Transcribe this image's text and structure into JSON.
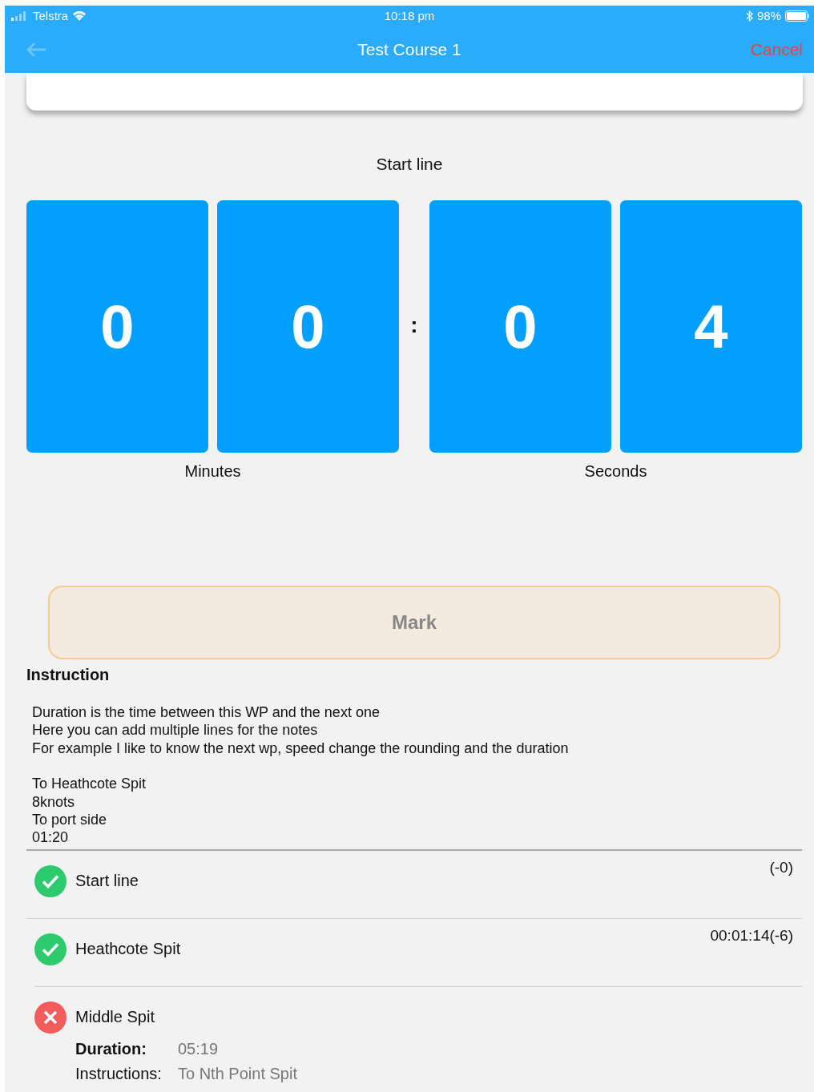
{
  "status_bar": {
    "carrier": "Telstra",
    "time": "10:18 pm",
    "battery": "98%"
  },
  "nav": {
    "title": "Test Course 1",
    "cancel": "Cancel"
  },
  "timer": {
    "title": "Start line",
    "separator": ":",
    "groups": [
      {
        "label": "Minutes",
        "digits": [
          "0",
          "0"
        ]
      },
      {
        "label": "Seconds",
        "digits": [
          "0",
          "4"
        ]
      }
    ]
  },
  "mark_button": {
    "label": "Mark"
  },
  "instruction": {
    "heading": "Instruction",
    "paragraphs": [
      [
        "Duration is the time between this WP and the next one",
        "Here you can add multiple lines for the notes",
        "For example I like to know the next wp, speed change the rounding and the duration"
      ],
      [
        "To Heathcote Spit",
        "8knots",
        "To port side",
        "01:20"
      ]
    ]
  },
  "waypoints": [
    {
      "name": "Start line",
      "passed": true,
      "result": "(-0)"
    },
    {
      "name": "Heathcote Spit",
      "passed": true,
      "result": "00:01:14(-6)"
    },
    {
      "name": "Middle Spit",
      "passed": false,
      "details": [
        {
          "label": "Duration:",
          "value": "05:19",
          "bold": true
        },
        {
          "label": "Instructions:",
          "value": "To Nth Point Spit",
          "bold": false
        }
      ]
    }
  ]
}
